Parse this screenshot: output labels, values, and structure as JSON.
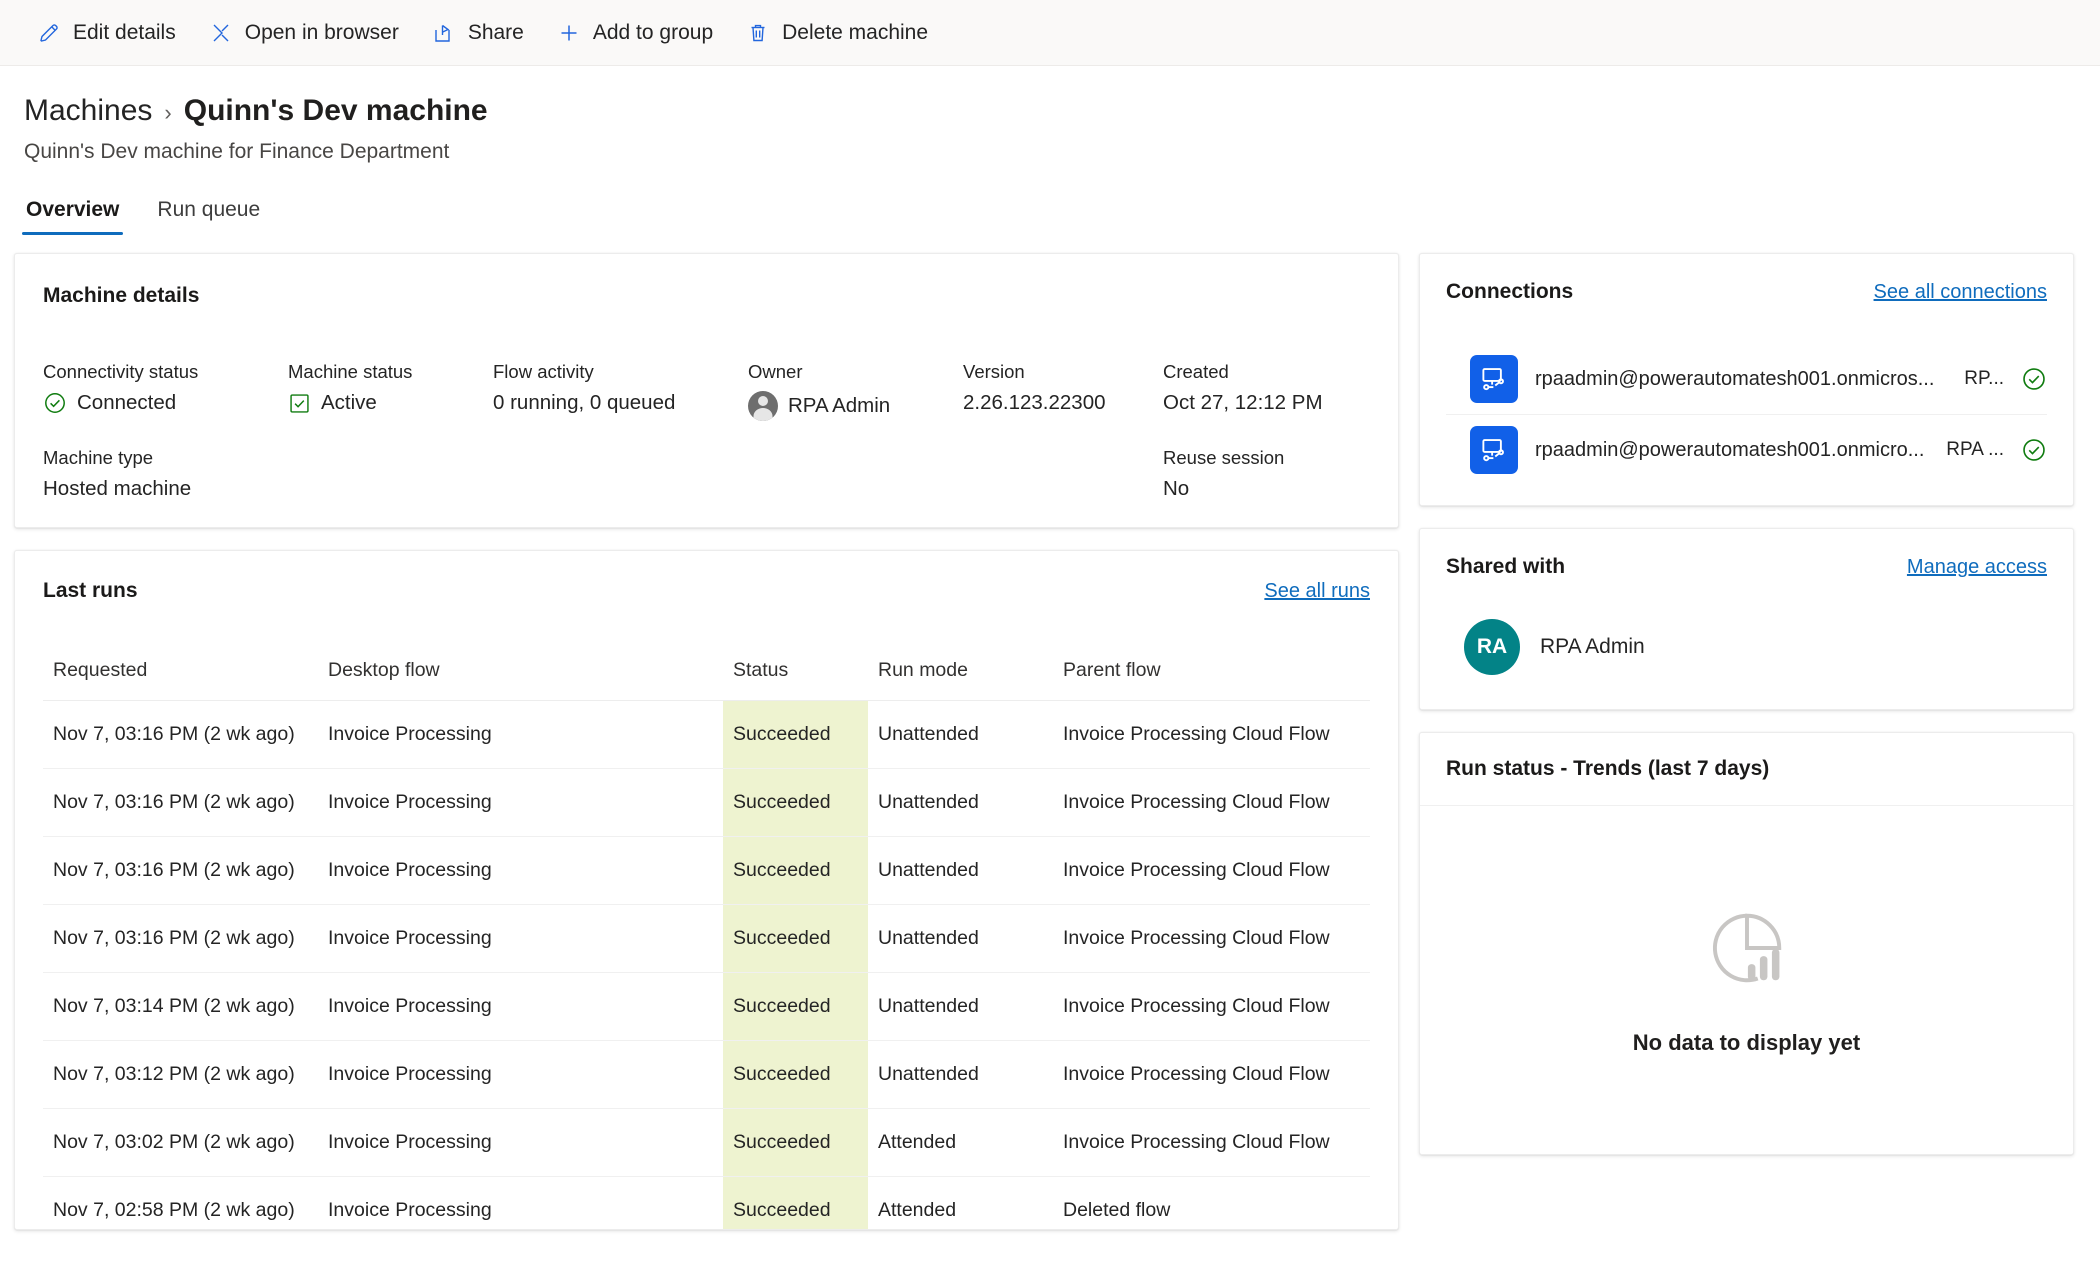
{
  "commandbar": {
    "items": [
      {
        "icon": "pencil-icon",
        "label": "Edit details"
      },
      {
        "icon": "open-in-browser-icon",
        "label": "Open in browser"
      },
      {
        "icon": "share-icon",
        "label": "Share"
      },
      {
        "icon": "plus-icon",
        "label": "Add to group"
      },
      {
        "icon": "trash-icon",
        "label": "Delete machine"
      }
    ]
  },
  "header": {
    "breadcrumb_parent": "Machines",
    "breadcrumb_separator": "›",
    "title": "Quinn's Dev machine",
    "subtitle": "Quinn's Dev machine for Finance Department"
  },
  "tabs": [
    {
      "label": "Overview",
      "active": true
    },
    {
      "label": "Run queue",
      "active": false
    }
  ],
  "machine_details": {
    "card_title": "Machine details",
    "fields": [
      {
        "label": "Connectivity status",
        "value": "Connected",
        "icon": "check-circle-icon"
      },
      {
        "label": "Machine status",
        "value": "Active",
        "icon": "check-square-icon"
      },
      {
        "label": "Flow activity",
        "value": "0 running, 0 queued",
        "icon": ""
      },
      {
        "label": "Owner",
        "value": "RPA Admin",
        "icon": "person-avatar-icon"
      },
      {
        "label": "Version",
        "value": "2.26.123.22300",
        "icon": ""
      },
      {
        "label": "Created",
        "value": "Oct 27, 12:12 PM",
        "icon": ""
      },
      {
        "label": "Machine type",
        "value": "Hosted machine",
        "icon": ""
      },
      {
        "label": "Reuse session",
        "value": "No",
        "icon": ""
      }
    ]
  },
  "last_runs": {
    "card_title": "Last runs",
    "see_all_label": "See all runs",
    "columns": [
      "Requested",
      "Desktop flow",
      "Status",
      "Run mode",
      "Parent flow"
    ],
    "rows": [
      {
        "requested": "Nov 7, 03:16 PM (2 wk ago)",
        "flow": "Invoice Processing",
        "status": "Succeeded",
        "mode": "Unattended",
        "parent": "Invoice Processing Cloud Flow",
        "parent_deleted": false
      },
      {
        "requested": "Nov 7, 03:16 PM (2 wk ago)",
        "flow": "Invoice Processing",
        "status": "Succeeded",
        "mode": "Unattended",
        "parent": "Invoice Processing Cloud Flow",
        "parent_deleted": false
      },
      {
        "requested": "Nov 7, 03:16 PM (2 wk ago)",
        "flow": "Invoice Processing",
        "status": "Succeeded",
        "mode": "Unattended",
        "parent": "Invoice Processing Cloud Flow",
        "parent_deleted": false
      },
      {
        "requested": "Nov 7, 03:16 PM (2 wk ago)",
        "flow": "Invoice Processing",
        "status": "Succeeded",
        "mode": "Unattended",
        "parent": "Invoice Processing Cloud Flow",
        "parent_deleted": false
      },
      {
        "requested": "Nov 7, 03:14 PM (2 wk ago)",
        "flow": "Invoice Processing",
        "status": "Succeeded",
        "mode": "Unattended",
        "parent": "Invoice Processing Cloud Flow",
        "parent_deleted": false
      },
      {
        "requested": "Nov 7, 03:12 PM (2 wk ago)",
        "flow": "Invoice Processing",
        "status": "Succeeded",
        "mode": "Unattended",
        "parent": "Invoice Processing Cloud Flow",
        "parent_deleted": false
      },
      {
        "requested": "Nov 7, 03:02 PM (2 wk ago)",
        "flow": "Invoice Processing",
        "status": "Succeeded",
        "mode": "Attended",
        "parent": "Invoice Processing Cloud Flow",
        "parent_deleted": false
      },
      {
        "requested": "Nov 7, 02:58 PM (2 wk ago)",
        "flow": "Invoice Processing",
        "status": "Succeeded",
        "mode": "Attended",
        "parent": "Deleted flow",
        "parent_deleted": true
      }
    ]
  },
  "connections": {
    "card_title": "Connections",
    "see_all_label": "See all connections",
    "items": [
      {
        "name": "rpaadmin@powerautomatesh001.onmicros...",
        "owner": "RP...",
        "status_icon": "check-circle-icon"
      },
      {
        "name": "rpaadmin@powerautomatesh001.onmicro...",
        "owner": "RPA ...",
        "status_icon": "check-circle-icon"
      }
    ]
  },
  "shared_with": {
    "card_title": "Shared with",
    "manage_label": "Manage access",
    "people": [
      {
        "initials": "RA",
        "name": "RPA Admin"
      }
    ]
  },
  "run_status_trends": {
    "card_title": "Run status - Trends (last 7 days)",
    "empty_message": "No data to display yet",
    "empty_icon": "pie-bar-chart-icon"
  },
  "colors": {
    "accent": "#0f6cbd",
    "success": "#107c10",
    "status_cell_bg": "#eef3d0",
    "connection_icon_bg": "#1160e8",
    "avatar_teal": "#038387"
  }
}
